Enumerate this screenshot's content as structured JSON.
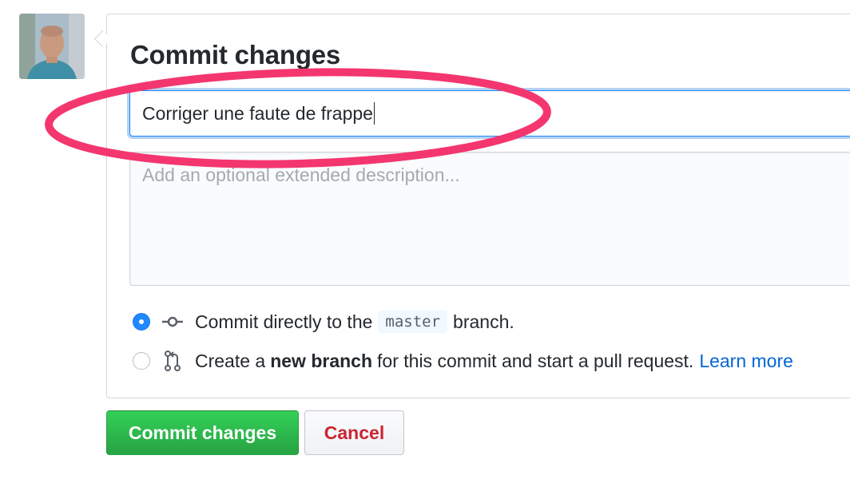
{
  "commit": {
    "title": "Commit changes",
    "summary_value": "Corriger une faute de frappe",
    "description_placeholder": "Add an optional extended description..."
  },
  "options": [
    {
      "text_before": "Commit directly to the",
      "branch": "master",
      "text_after": "branch.",
      "selected": true,
      "icon": "git-commit-icon"
    },
    {
      "text_before": "Create a",
      "bold": "new branch",
      "text_after": "for this commit and start a pull request.",
      "link": "Learn more",
      "selected": false,
      "icon": "git-pull-request-icon"
    }
  ],
  "buttons": {
    "commit_label": "Commit changes",
    "cancel_label": "Cancel"
  },
  "colors": {
    "annotation": "#f4366f",
    "primary_button": "#28a745",
    "cancel_text": "#cb2431",
    "link": "#0366d6",
    "focus": "#2188ff"
  }
}
